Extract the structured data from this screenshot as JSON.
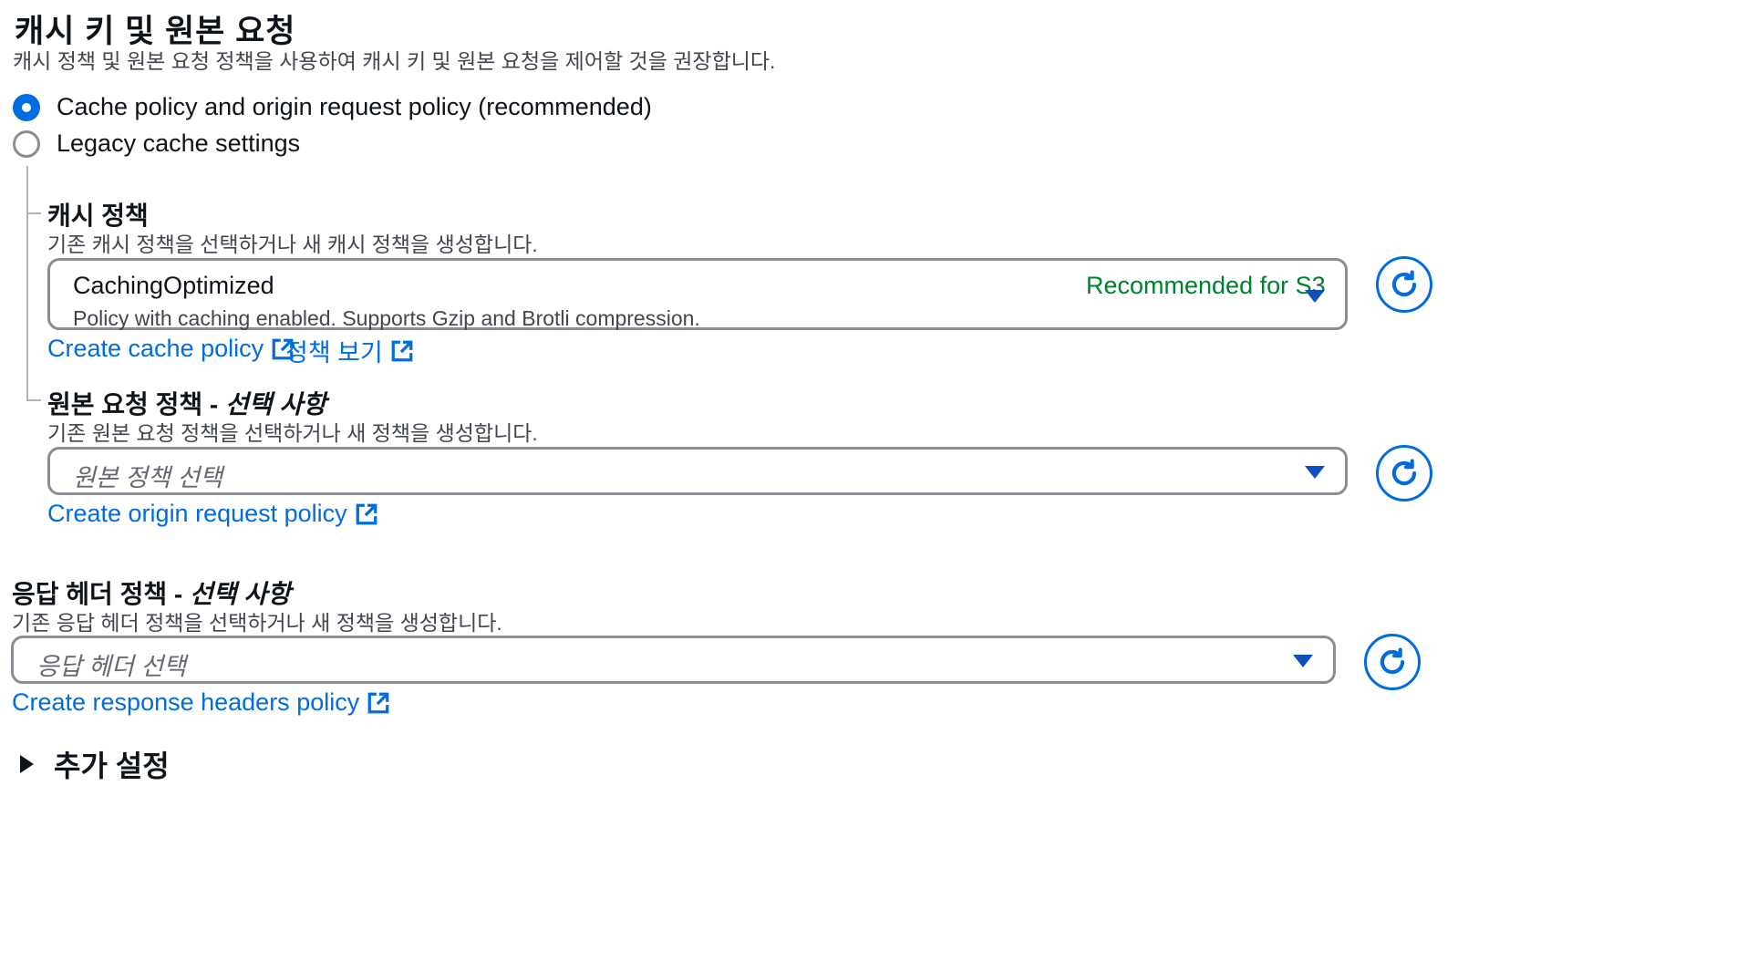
{
  "section": {
    "title": "캐시 키 및 원본 요청",
    "description": "캐시 정책 및 원본 요청 정책을 사용하여 캐시 키 및 원본 요청을 제어할 것을 권장합니다."
  },
  "radio_options": [
    {
      "label": "Cache policy and origin request policy (recommended)",
      "selected": true
    },
    {
      "label": "Legacy cache settings",
      "selected": false
    }
  ],
  "cache_policy": {
    "title": "캐시 정책",
    "description": "기존 캐시 정책을 선택하거나 새 캐시 정책을 생성합니다.",
    "selected_value": "CachingOptimized",
    "selected_description": "Policy with caching enabled. Supports Gzip and Brotli compression.",
    "tag": "Recommended for S3",
    "create_link": "Create cache policy",
    "view_link": "정책 보기"
  },
  "origin_request_policy": {
    "title": "원본 요청 정책 - ",
    "optional": "선택 사항",
    "description": "기존 원본 요청 정책을 선택하거나 새 정책을 생성합니다.",
    "placeholder": "원본 정책 선택",
    "create_link": "Create origin request policy"
  },
  "response_headers_policy": {
    "title": "응답 헤더 정책 - ",
    "optional": "선택 사항",
    "description": "기존 응답 헤더 정책을 선택하거나 새 정책을 생성합니다.",
    "placeholder": "응답 헤더 선택",
    "create_link": "Create response headers policy"
  },
  "additional_settings": {
    "label": "추가 설정",
    "expanded": false
  },
  "colors": {
    "link": "#006ce0",
    "tag": "#00802f",
    "selected_radio": "#006ce0"
  },
  "icons": [
    "radio-selected-icon",
    "radio-unselected-icon",
    "caret-down-icon",
    "refresh-icon",
    "external-link-icon",
    "expand-triangle-icon"
  ]
}
